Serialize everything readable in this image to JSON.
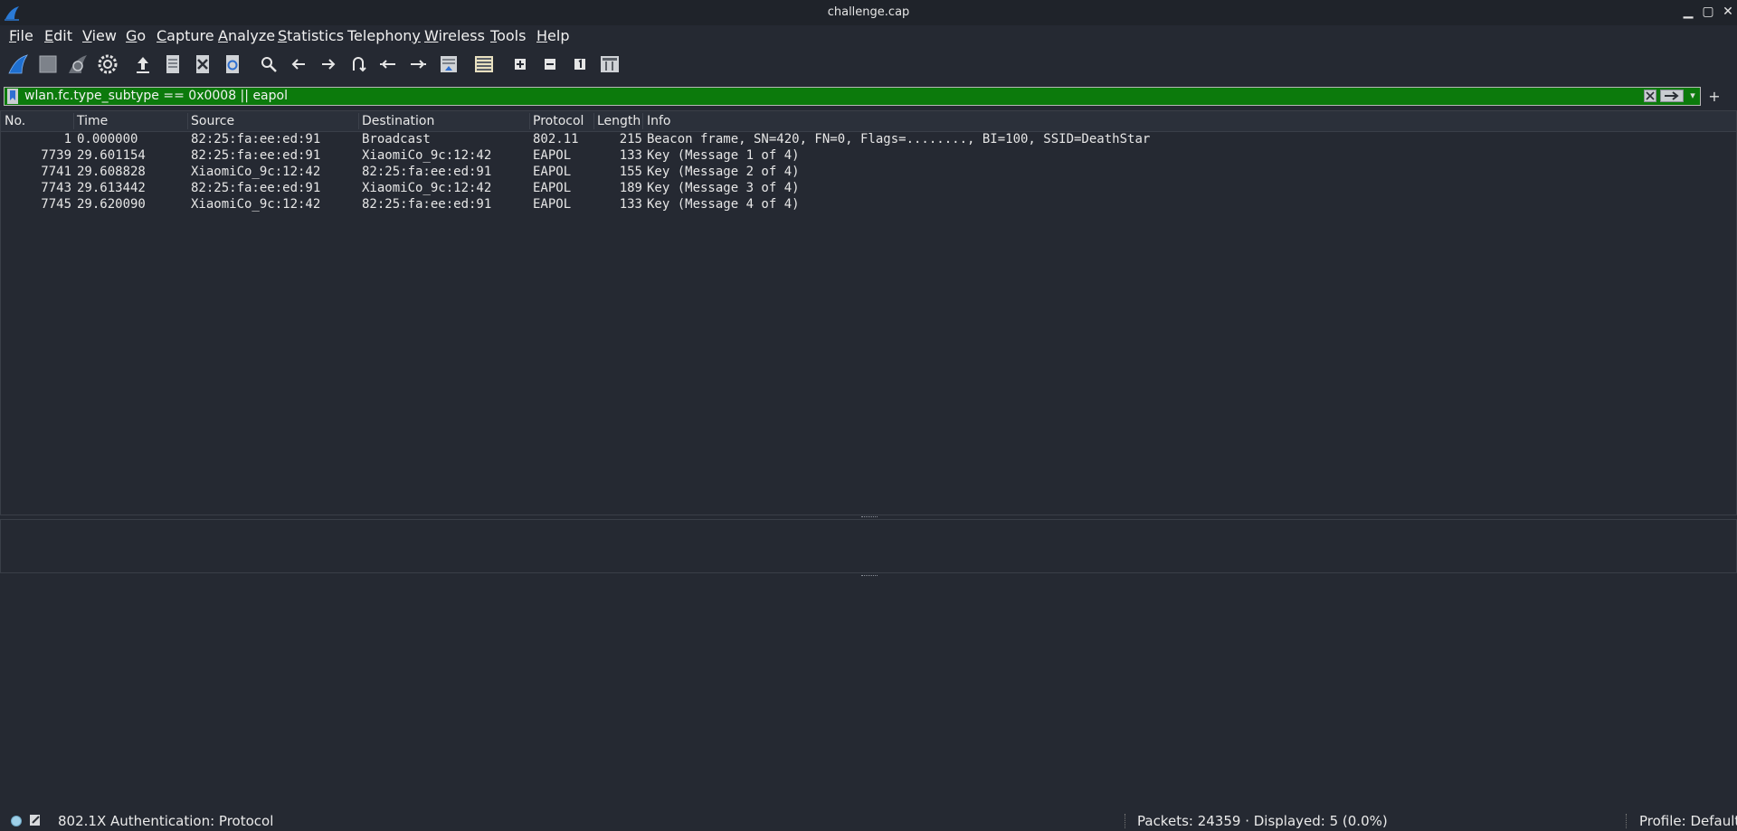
{
  "window": {
    "title": "challenge.cap",
    "minimize": "▁",
    "maximize": "▢",
    "close": "✕"
  },
  "menu": [
    {
      "pre": "",
      "u": "F",
      "post": "ile"
    },
    {
      "pre": "",
      "u": "E",
      "post": "dit"
    },
    {
      "pre": "",
      "u": "V",
      "post": "iew"
    },
    {
      "pre": "",
      "u": "G",
      "post": "o"
    },
    {
      "pre": "",
      "u": "C",
      "post": "apture"
    },
    {
      "pre": "",
      "u": "A",
      "post": "nalyze"
    },
    {
      "pre": "",
      "u": "S",
      "post": "tatistics"
    },
    {
      "pre": "Telephon",
      "u": "y",
      "post": ""
    },
    {
      "pre": "",
      "u": "W",
      "post": "ireless"
    },
    {
      "pre": "",
      "u": "T",
      "post": "ools"
    },
    {
      "pre": "",
      "u": "H",
      "post": "elp"
    }
  ],
  "toolbar": {
    "icons": [
      "start-capture-icon",
      "stop-capture-icon",
      "restart-capture-icon",
      "capture-options-icon",
      "open-file-icon",
      "save-file-icon",
      "close-file-icon",
      "reload-file-icon",
      "find-packet-icon",
      "go-back-icon",
      "go-forward-icon",
      "go-to-packet-icon",
      "go-first-icon",
      "go-last-icon",
      "auto-scroll-icon",
      "colorize-icon",
      "zoom-in-icon",
      "zoom-out-icon",
      "normal-size-icon",
      "resize-columns-icon"
    ],
    "accent": "#1e6fd0"
  },
  "filter": {
    "value": "wlan.fc.type_subtype == 0x0008 || eapol",
    "bg": "#0c7a0c",
    "clear": "⊠",
    "apply": "➡",
    "dropdown": "▾",
    "add": "+"
  },
  "columns": [
    "No.",
    "Time",
    "Source",
    "Destination",
    "Protocol",
    "Length",
    "Info"
  ],
  "packets": [
    {
      "no": "1",
      "time": "0.000000",
      "src": "82:25:fa:ee:ed:91",
      "dst": "Broadcast",
      "proto": "802.11",
      "len": "215",
      "info": "Beacon frame, SN=420, FN=0, Flags=........, BI=100, SSID=DeathStar"
    },
    {
      "no": "7739",
      "time": "29.601154",
      "src": "82:25:fa:ee:ed:91",
      "dst": "XiaomiCo_9c:12:42",
      "proto": "EAPOL",
      "len": "133",
      "info": "Key (Message 1 of 4)"
    },
    {
      "no": "7741",
      "time": "29.608828",
      "src": "XiaomiCo_9c:12:42",
      "dst": "82:25:fa:ee:ed:91",
      "proto": "EAPOL",
      "len": "155",
      "info": "Key (Message 2 of 4)"
    },
    {
      "no": "7743",
      "time": "29.613442",
      "src": "82:25:fa:ee:ed:91",
      "dst": "XiaomiCo_9c:12:42",
      "proto": "EAPOL",
      "len": "189",
      "info": "Key (Message 3 of 4)"
    },
    {
      "no": "7745",
      "time": "29.620090",
      "src": "XiaomiCo_9c:12:42",
      "dst": "82:25:fa:ee:ed:91",
      "proto": "EAPOL",
      "len": "133",
      "info": "Key (Message 4 of 4)"
    }
  ],
  "status": {
    "field": "802.1X Authentication: Protocol",
    "packets": "Packets: 24359 · Displayed: 5 (0.0%)",
    "profile": "Profile: Default"
  }
}
